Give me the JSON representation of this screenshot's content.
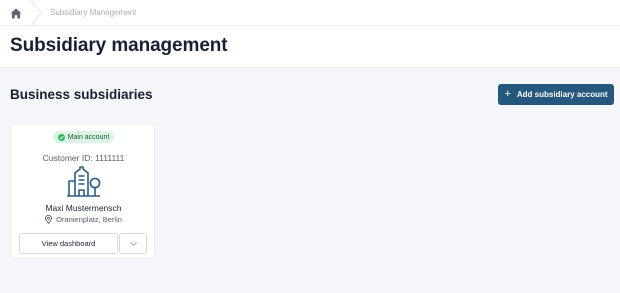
{
  "breadcrumb": {
    "home_icon": "home-icon",
    "current": "Subsidiary Management"
  },
  "header": {
    "title": "Subsidiary management"
  },
  "section": {
    "title": "Business subsidiaries",
    "add_button_label": "Add subsidiary account",
    "add_button_icon": "plus-icon"
  },
  "colors": {
    "primary": "#25587f",
    "badge_bg": "#dcf4e5",
    "badge_dot": "#34b35f",
    "icon": "#2c5c82"
  },
  "card": {
    "badge": "Main account",
    "customer_id": "Customer ID: 1111111",
    "icon": "building-icon",
    "name": "Maxi Mustermensch",
    "location": "Oranienplatz, Berlin",
    "location_icon": "location-pin-icon",
    "view_button": "View dashboard",
    "more_icon": "chevron-down-icon"
  }
}
